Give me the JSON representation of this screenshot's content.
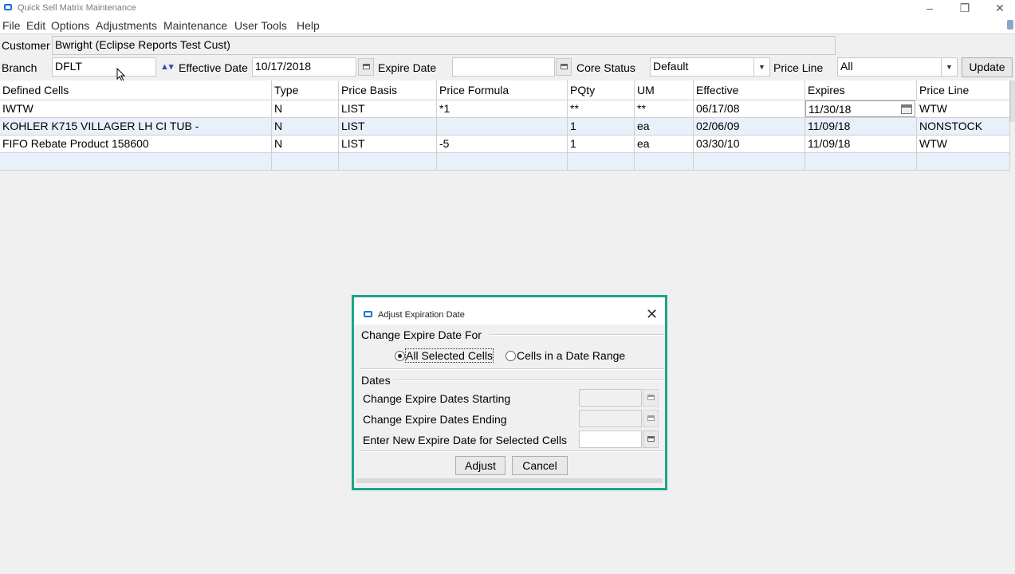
{
  "window": {
    "title": "Quick Sell Matrix Maintenance"
  },
  "menu": [
    "File",
    "Edit",
    "Options",
    "Adjustments",
    "Maintenance",
    "User Tools",
    "Help"
  ],
  "customer": {
    "label": "Customer",
    "value": "Bwright (Eclipse Reports Test Cust)"
  },
  "filters": {
    "branch_label": "Branch",
    "branch_value": "DFLT",
    "effective_label": "Effective Date",
    "effective_value": "10/17/2018",
    "expire_label": "Expire Date",
    "expire_value": "",
    "core_status_label": "Core Status",
    "core_status_value": "Default",
    "price_line_label": "Price Line",
    "price_line_value": "All",
    "update_label": "Update"
  },
  "grid": {
    "columns": [
      "Defined Cells",
      "Type",
      "Price Basis",
      "Price Formula",
      "PQty",
      "UM",
      "Effective",
      "Expires",
      "Price Line"
    ],
    "rows": [
      [
        "IWTW",
        "N",
        "LIST",
        "*1",
        "**",
        "**",
        "06/17/08",
        "11/30/18",
        "WTW"
      ],
      [
        "KOHLER K715 VILLAGER LH CI TUB -",
        "N",
        "LIST",
        "",
        "1",
        "ea",
        "02/06/09",
        "11/09/18",
        "NONSTOCK"
      ],
      [
        "FIFO Rebate Product 158600",
        "N",
        "LIST",
        "-5",
        "1",
        "ea",
        "03/30/10",
        "11/09/18",
        "WTW"
      ]
    ]
  },
  "dialog": {
    "title": "Adjust Expiration Date",
    "group1_label": "Change Expire Date For",
    "option_all": "All Selected Cells",
    "option_range": "Cells in a Date Range",
    "group2_label": "Dates",
    "starting_label": "Change Expire Dates Starting",
    "ending_label": "Change Expire Dates Ending",
    "new_label": "Enter New Expire Date for Selected Cells",
    "adjust_label": "Adjust",
    "cancel_label": "Cancel"
  }
}
